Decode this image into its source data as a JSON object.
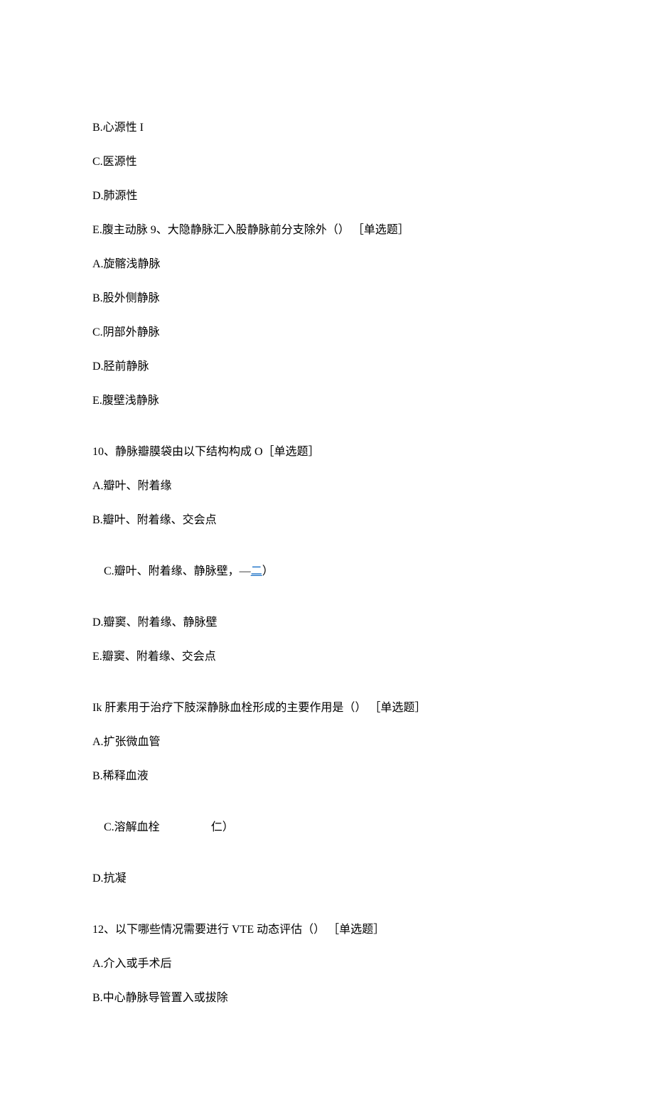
{
  "lines": {
    "l1": "B.心源性 I",
    "l2": "C.医源性",
    "l3": "D.肺源性",
    "l4": "E.腹主动脉 9、大隐静脉汇入股静脉前分支除外（） ［单选题］",
    "l5": "A.旋髂浅静脉",
    "l6": "B.股外侧静脉",
    "l7": "C.阴部外静脉",
    "l8": "D.胫前静脉",
    "l9": "E.腹壁浅静脉",
    "l10": "10、静脉瓣膜袋由以下结构构成 O［单选题］",
    "l11": "A.瓣叶、附着缘",
    "l12": "B.瓣叶、附着缘、交会点",
    "l13_a": "C.瓣叶、附着缘、静脉壁，—",
    "l13_b": "二",
    "l13_c": "）",
    "l14": "D.瓣窦、附着缘、静脉壁",
    "l15": "E.瓣窦、附着缘、交会点",
    "l16": "Ik 肝素用于治疗下肢深静脉血栓形成的主要作用是（） ［单选题］",
    "l17": "A.扩张微血管",
    "l18": "B.稀释血液",
    "l19_a": "C.溶解血栓",
    "l19_b": "仁）",
    "l20": "D.抗凝",
    "l21": "12、以下哪些情况需要进行 VTE 动态评估（） ［单选题］",
    "l22": "A.介入或手术后",
    "l23": "B.中心静脉导管置入或拔除"
  }
}
